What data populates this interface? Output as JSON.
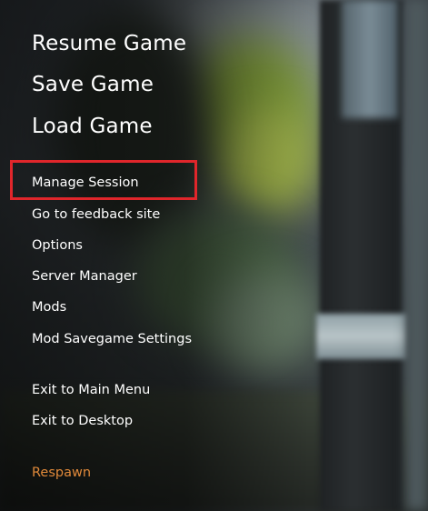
{
  "menu": {
    "primary": [
      {
        "label": "Resume Game"
      },
      {
        "label": "Save Game"
      },
      {
        "label": "Load Game"
      }
    ],
    "secondary": [
      {
        "label": "Manage Session"
      },
      {
        "label": "Go to feedback site"
      },
      {
        "label": "Options"
      },
      {
        "label": "Server Manager"
      },
      {
        "label": "Mods"
      },
      {
        "label": "Mod Savegame Settings"
      }
    ],
    "exit": [
      {
        "label": "Exit to Main Menu"
      },
      {
        "label": "Exit to Desktop"
      }
    ],
    "respawn": {
      "label": "Respawn"
    }
  },
  "colors": {
    "text": "#ffffff",
    "respawn": "#e0893a",
    "highlight": "#e0262b"
  }
}
